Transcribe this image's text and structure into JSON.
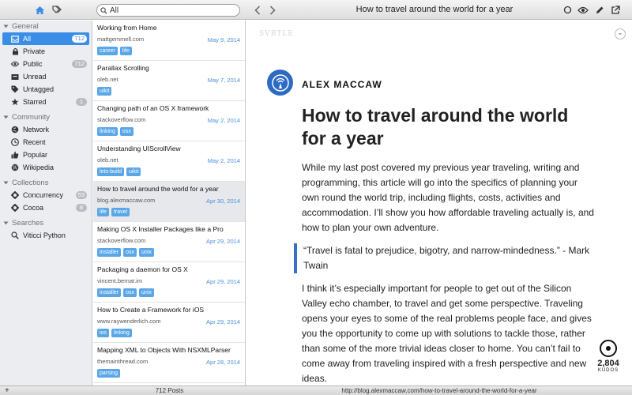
{
  "toolbar": {
    "search_value": "All",
    "title": "How to travel around the world for a year",
    "icons": [
      "home-icon",
      "tags-icon",
      "back-icon",
      "forward-icon",
      "unread-circle-icon",
      "eye-icon",
      "pencil-icon",
      "share-icon"
    ]
  },
  "sidebar": {
    "general": {
      "title": "General",
      "items": [
        {
          "label": "All",
          "badge": "712"
        },
        {
          "label": "Private"
        },
        {
          "label": "Public",
          "badge": "712"
        },
        {
          "label": "Unread"
        },
        {
          "label": "Untagged"
        },
        {
          "label": "Starred",
          "badge": "1"
        }
      ]
    },
    "community": {
      "title": "Community",
      "items": [
        {
          "label": "Network"
        },
        {
          "label": "Recent"
        },
        {
          "label": "Popular"
        },
        {
          "label": "Wikipedia"
        }
      ]
    },
    "collections": {
      "title": "Collections",
      "items": [
        {
          "label": "Concurrency",
          "badge": "53"
        },
        {
          "label": "Cocoa",
          "badge": "8"
        }
      ]
    },
    "searches": {
      "title": "Searches",
      "items": [
        {
          "label": "Viticci Python"
        }
      ]
    }
  },
  "articles": [
    {
      "title": "Working from Home",
      "source": "mattgemmell.com",
      "date": "May 9, 2014",
      "tags": [
        "career",
        "life"
      ]
    },
    {
      "title": "Parallax Scrolling",
      "source": "oleb.net",
      "date": "May 7, 2014",
      "tags": [
        "uikit"
      ]
    },
    {
      "title": "Changing path of an OS X framework",
      "source": "stackoverflow.com",
      "date": "May 2, 2014",
      "tags": [
        "linking",
        "osx"
      ]
    },
    {
      "title": "Understanding UIScrollView",
      "source": "oleb.net",
      "date": "May 2, 2014",
      "tags": [
        "lets-build",
        "uikit"
      ]
    },
    {
      "title": "How to travel around the world for a year",
      "source": "blog.alexmaccaw.com",
      "date": "Apr 30, 2014",
      "tags": [
        "life",
        "travel"
      ]
    },
    {
      "title": "Making OS X Installer Packages like a Pro",
      "source": "stackoverflow.com",
      "date": "Apr 29, 2014",
      "tags": [
        "installer",
        "osx",
        "unix"
      ]
    },
    {
      "title": "Packaging a daemon for OS X",
      "source": "vincent.bernat.im",
      "date": "Apr 29, 2014",
      "tags": [
        "installer",
        "osx",
        "unix"
      ]
    },
    {
      "title": "How to Create a Framework for iOS",
      "source": "www.raywenderlich.com",
      "date": "Apr 29, 2014",
      "tags": [
        "ios",
        "linking"
      ]
    },
    {
      "title": "Mapping XML to Objects With NSXMLParser",
      "source": "themainthread.com",
      "date": "Apr 28, 2014",
      "tags": [
        "parsing"
      ]
    }
  ],
  "reader": {
    "feed_label": "SVBTLE",
    "author": "ALEX MACCAW",
    "title": "How to travel around the world for a year",
    "para1": "While my last post covered my previous year traveling, writing and programming, this article will go into the specifics of planning your own round the world trip, including flights, costs, activities and accommodation. I’ll show you how affordable traveling actually is, and how to plan your own adventure.",
    "quote": "“Travel is fatal to prejudice, bigotry, and narrow-mindedness.” - Mark Twain",
    "para2": "I think it’s especially important for people to get out of the Silicon Valley echo chamber, to travel and get some perspective. Traveling opens your eyes to some of the real problems people face, and gives you the opportunity to come up with solutions to tackle those, rather than some of the more trivial ideas closer to home. You can’t fail to come away from traveling inspired with a fresh perspective and new ideas.",
    "kudos_count": "2,804",
    "kudos_label": "KUDOS"
  },
  "status": {
    "add_label": "+",
    "post_count": "712 Posts",
    "url": "http://blog.alexmaccaw.com/how-to-travel-around-the-world-for-a-year"
  }
}
